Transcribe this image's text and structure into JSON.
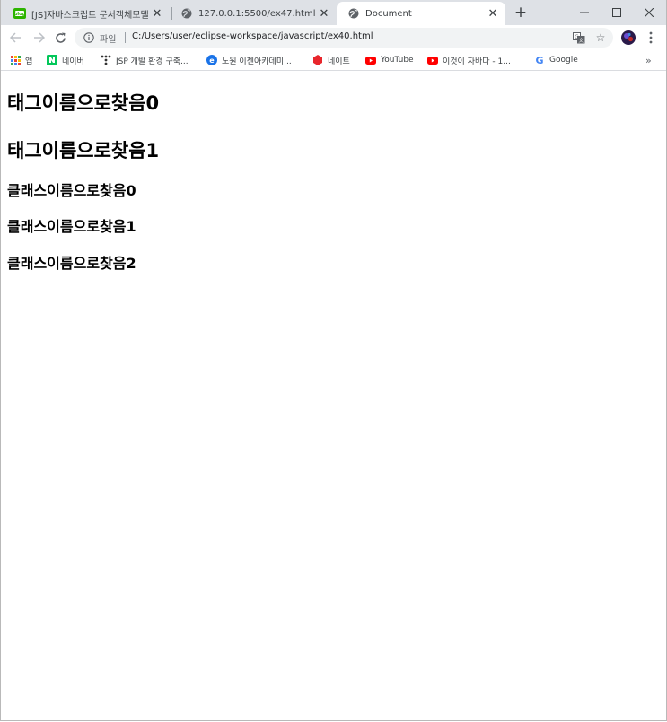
{
  "browser": {
    "tabs": [
      {
        "title": "[JS]자바스크립트 문서객체모델",
        "favicon": "blog-icon"
      },
      {
        "title": "127.0.0.1:5500/ex47.html",
        "favicon": "globe-icon"
      },
      {
        "title": "Document",
        "favicon": "globe-icon"
      }
    ],
    "active_tab": 2,
    "address": {
      "label": "파일",
      "url": "C:/Users/user/eclipse-workspace/javascript/ex40.html"
    },
    "bookmarks": [
      {
        "label": "앱",
        "icon": "apps-icon"
      },
      {
        "label": "네이버",
        "icon": "naver-icon"
      },
      {
        "label": "JSP 개발 환경 구축...",
        "icon": "tistory-icon"
      },
      {
        "label": "노원 이젠아카데미...",
        "icon": "ezen-icon"
      },
      {
        "label": "네이트",
        "icon": "nate-icon"
      },
      {
        "label": "YouTube",
        "icon": "youtube-icon"
      },
      {
        "label": "이것이 자바다 - 1...",
        "icon": "youtube-icon"
      },
      {
        "label": "Google",
        "icon": "google-icon"
      }
    ],
    "more_bookmarks": "»"
  },
  "page": {
    "headings_tag": [
      "태그이름으로찾음0",
      "태그이름으로찾음1"
    ],
    "headings_class": [
      "클래스이름으로찾음0",
      "클래스이름으로찾음1",
      "클래스이름으로찾음2"
    ]
  },
  "colors": {
    "tabstrip": "#dee1e6",
    "omnibox": "#f1f3f4",
    "naver": "#03c75a",
    "youtube": "#ff0000",
    "nate": "#e8262c",
    "ezen": "#1a73e8"
  }
}
